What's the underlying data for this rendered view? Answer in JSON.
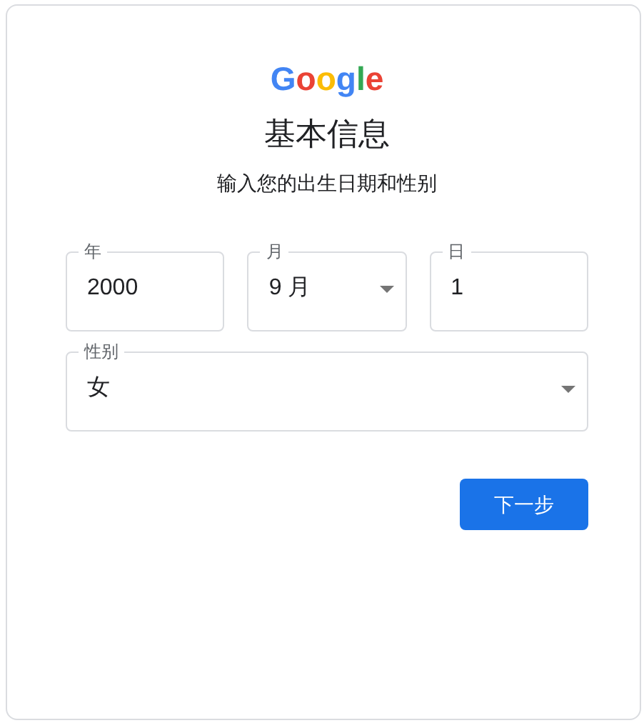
{
  "logo": [
    {
      "letter": "G",
      "color": "#4285f4"
    },
    {
      "letter": "o",
      "color": "#ea4335"
    },
    {
      "letter": "o",
      "color": "#fbbc05"
    },
    {
      "letter": "g",
      "color": "#4285f4"
    },
    {
      "letter": "l",
      "color": "#34a853"
    },
    {
      "letter": "e",
      "color": "#ea4335"
    }
  ],
  "title": "基本信息",
  "subtitle": "输入您的出生日期和性别",
  "date_fields": [
    {
      "label": "年",
      "value": "2000",
      "kind": "text"
    },
    {
      "label": "月",
      "value": "9 月",
      "kind": "select"
    },
    {
      "label": "日",
      "value": "1",
      "kind": "text"
    }
  ],
  "gender_field": {
    "label": "性别",
    "value": "女",
    "kind": "select"
  },
  "next_button": "下一步"
}
